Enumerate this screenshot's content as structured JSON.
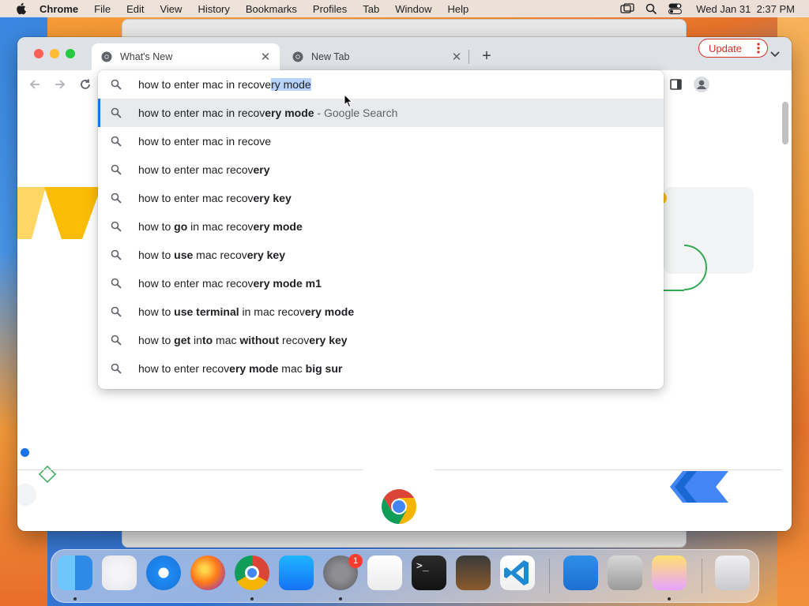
{
  "menubar": {
    "app_name": "Chrome",
    "items": [
      "File",
      "Edit",
      "View",
      "History",
      "Bookmarks",
      "Profiles",
      "Tab",
      "Window",
      "Help"
    ],
    "datetime": "Wed Jan 31  2:37 PM"
  },
  "tabs": [
    {
      "label": "What's New",
      "active": true
    },
    {
      "label": "New Tab",
      "active": false
    }
  ],
  "toolbar": {
    "update_label": "Update"
  },
  "omnibox": {
    "typed": "how to enter mac in recove",
    "autocomplete": "ry mode",
    "suggestions": [
      {
        "parts": [
          {
            "t": "how to enter mac in recov",
            "b": false
          },
          {
            "t": "ery mode",
            "b": true
          }
        ],
        "suffix": " - Google Search"
      },
      {
        "parts": [
          {
            "t": "how to enter mac in recove",
            "b": false
          }
        ],
        "suffix": ""
      },
      {
        "parts": [
          {
            "t": "how to enter mac recov",
            "b": false
          },
          {
            "t": "ery",
            "b": true
          }
        ],
        "suffix": ""
      },
      {
        "parts": [
          {
            "t": "how to enter mac recov",
            "b": false
          },
          {
            "t": "ery key",
            "b": true
          }
        ],
        "suffix": ""
      },
      {
        "parts": [
          {
            "t": "how to ",
            "b": false
          },
          {
            "t": "go",
            "b": true
          },
          {
            "t": " in mac recov",
            "b": false
          },
          {
            "t": "ery mode",
            "b": true
          }
        ],
        "suffix": ""
      },
      {
        "parts": [
          {
            "t": "how to ",
            "b": false
          },
          {
            "t": "use",
            "b": true
          },
          {
            "t": " mac recov",
            "b": false
          },
          {
            "t": "ery key",
            "b": true
          }
        ],
        "suffix": ""
      },
      {
        "parts": [
          {
            "t": "how to enter mac recov",
            "b": false
          },
          {
            "t": "ery mode m1",
            "b": true
          }
        ],
        "suffix": ""
      },
      {
        "parts": [
          {
            "t": "how to ",
            "b": false
          },
          {
            "t": "use terminal",
            "b": true
          },
          {
            "t": " in mac recov",
            "b": false
          },
          {
            "t": "ery mode",
            "b": true
          }
        ],
        "suffix": ""
      },
      {
        "parts": [
          {
            "t": "how to ",
            "b": false
          },
          {
            "t": "get",
            "b": true
          },
          {
            "t": " in",
            "b": false
          },
          {
            "t": "to",
            "b": true
          },
          {
            "t": " mac ",
            "b": false
          },
          {
            "t": "without",
            "b": true
          },
          {
            "t": " recov",
            "b": false
          },
          {
            "t": "ery key",
            "b": true
          }
        ],
        "suffix": ""
      },
      {
        "parts": [
          {
            "t": "how to enter recov",
            "b": false
          },
          {
            "t": "ery mode",
            "b": true
          },
          {
            "t": " mac ",
            "b": false
          },
          {
            "t": "big sur",
            "b": true
          }
        ],
        "suffix": ""
      }
    ]
  },
  "dock": {
    "apps": [
      "finder-icon",
      "launchpad-icon",
      "safari-icon",
      "firefox-icon",
      "chrome-icon",
      "app-store-icon",
      "system-preferences-icon",
      "textedit-icon",
      "terminal-icon",
      "garageband-icon",
      "vscode-icon",
      "weather-icon",
      "disk-utility-icon",
      "instruments-icon",
      "trash-icon"
    ],
    "system_preferences_badge": "1"
  },
  "colors": {
    "accent": "#1a73e8",
    "update": "#d93025",
    "selection": "#b7d3f9"
  }
}
